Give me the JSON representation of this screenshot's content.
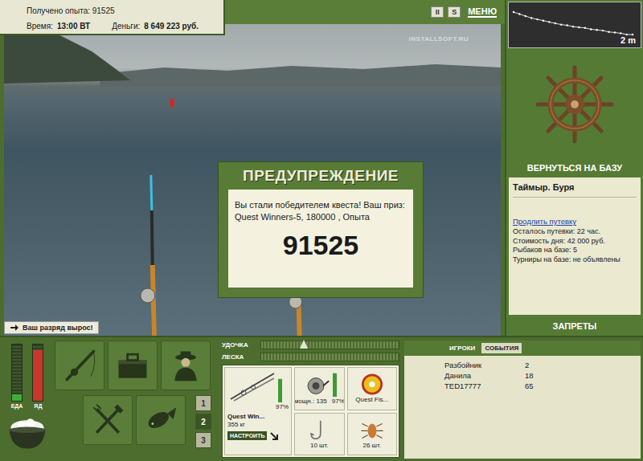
{
  "stats": {
    "experience": "Получено опыта: 91525",
    "time_label": "Время:",
    "time": "13:00 ВТ",
    "money_label": "Деньги:",
    "money": "8 649 223 руб."
  },
  "top_buttons": [
    {
      "label": "II",
      "kind": "box"
    },
    {
      "label": "S",
      "kind": "box"
    },
    {
      "label": "МЕНЮ",
      "kind": "text"
    }
  ],
  "watermark": "INSTALLSOFT.RU",
  "dialog": {
    "title": "ПРЕДУПРЕЖДЕНИЕ",
    "message": "Вы стали победителем квеста! Ваш приз: Quest Winners-5, 180000 , Опыта",
    "value": "91525"
  },
  "notification": "Ваш разряд вырос!",
  "depth_chart": {
    "values": [
      0.3,
      0.45,
      0.6,
      0.75,
      0.85,
      0.95,
      1.05,
      1.15,
      1.25,
      1.3,
      1.4,
      1.45,
      1.5,
      1.6,
      1.65,
      1.7,
      1.8,
      1.85,
      1.9,
      2.0,
      2.0
    ],
    "reading": "2 m"
  },
  "return_button": "ВЕРНУТЬСЯ НА БАЗУ",
  "location": {
    "title": "Таймыр. Буря",
    "link": "Продлить путевку",
    "lines": [
      "Осталось путевки: 22 час.",
      "Стоимость дня: 42 000 руб.",
      "Рыбаков на базе: 5",
      "Турниры на базе: не объявлены"
    ]
  },
  "bans_button": "ЗАПРЕТЫ",
  "meters": [
    {
      "label": "ЕДА",
      "level": 0.12,
      "color": "#3fae3a"
    },
    {
      "label": "ЯД",
      "level": 0.9,
      "color": "#c8382a"
    }
  ],
  "pages": [
    {
      "label": "1",
      "selected": false
    },
    {
      "label": "2",
      "selected": true
    },
    {
      "label": "3",
      "selected": false
    }
  ],
  "tension": {
    "bars": [
      {
        "label": "УДОЧКА",
        "level": 0
      },
      {
        "label": "ЛЕСКА",
        "level": 0
      }
    ],
    "marker": 0.31
  },
  "tackle": {
    "rod": {
      "name": "Quest Win...",
      "weight": "355 кг",
      "wear": "97%",
      "level": 0.97
    },
    "setup_button": "НАСТРОИТЬ",
    "reel": {
      "power": "мощн.: 135",
      "wear": "97%",
      "level": 0.97
    },
    "line": {
      "name": "Quest Fis..."
    },
    "hook": {
      "count": "10 шт."
    },
    "bait": {
      "count": "26 шт."
    }
  },
  "event_tabs": [
    {
      "label": "ИГРОКИ",
      "selected": false
    },
    {
      "label": "СОБЫТИЯ",
      "selected": true
    }
  ],
  "players": [
    {
      "name": "Разбойник",
      "value": "2"
    },
    {
      "name": "Данила",
      "value": "18"
    },
    {
      "name": "TED17777",
      "value": "65"
    }
  ]
}
